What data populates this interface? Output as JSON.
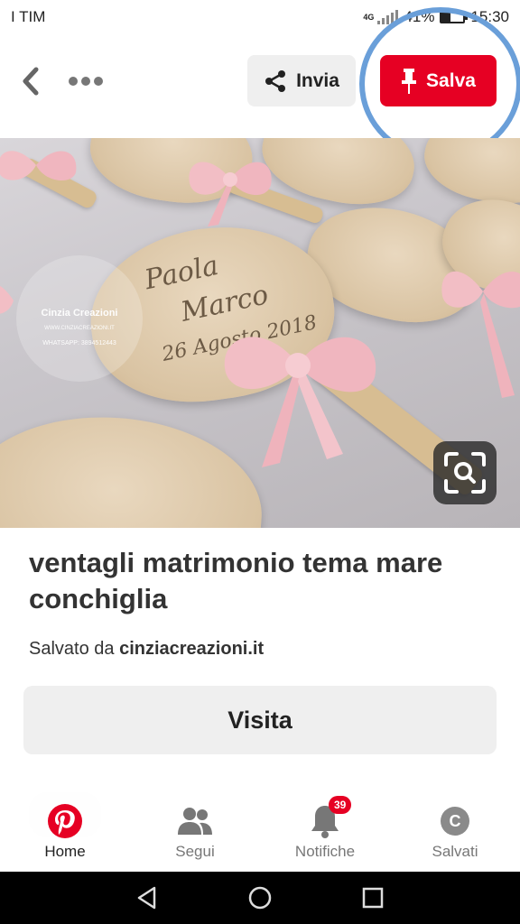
{
  "status_bar": {
    "carrier": "I TIM",
    "network": "4G",
    "battery_percent": "41%",
    "battery_level": 0.41,
    "time": "15:30"
  },
  "toolbar": {
    "send_label": "Invia",
    "save_label": "Salva"
  },
  "pin": {
    "watermark_name": "Cinzia Creazioni",
    "watermark_site": "WWW.CINZIACREAZIONI.IT",
    "watermark_phone": "WHATSAPP: 3894512443",
    "fan_text_1": "Paola",
    "fan_text_2": "Marco",
    "fan_text_3": "26 Agosto 2018",
    "title": "ventagli matrimonio tema mare conchiglia",
    "saved_prefix": "Salvato da",
    "saved_source": "cinziacreazioni.it",
    "visit_label": "Visita"
  },
  "bottom_nav": {
    "items": [
      {
        "label": "Home",
        "icon": "pinterest-icon"
      },
      {
        "label": "Segui",
        "icon": "people-icon"
      },
      {
        "label": "Notifiche",
        "icon": "bell-icon",
        "badge": "39"
      },
      {
        "label": "Salvati",
        "icon": "avatar-c",
        "avatar_letter": "C"
      }
    ]
  },
  "colors": {
    "brand_red": "#e60023",
    "highlight_ring": "#6a9fd9"
  }
}
